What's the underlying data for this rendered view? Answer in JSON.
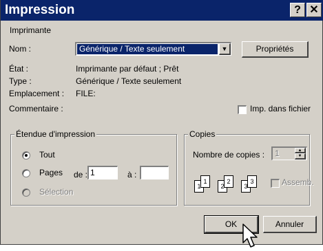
{
  "window": {
    "title": "Impression"
  },
  "printer": {
    "section_label": "Imprimante",
    "name_label": "Nom :",
    "name_value": "Générique / Texte seulement",
    "properties_button": "Propriétés",
    "state_label": "État :",
    "state_value": "Imprimante par défaut ; Prêt",
    "type_label": "Type :",
    "type_value": "Générique / Texte seulement",
    "location_label": "Emplacement :",
    "location_value": "FILE:",
    "comment_label": "Commentaire :",
    "print_to_file_label": "Imp. dans fichier"
  },
  "range": {
    "title": "Étendue d'impression",
    "all_label": "Tout",
    "pages_label": "Pages",
    "from_label": "de :",
    "from_value": "1",
    "to_label": "à :",
    "to_value": "",
    "selection_label": "Sélection"
  },
  "copies": {
    "title": "Copies",
    "count_label": "Nombre de copies :",
    "count_value": "1",
    "collate_label": "Assemb.",
    "page_numbers": [
      "1",
      "1",
      "2",
      "2",
      "3",
      "3"
    ]
  },
  "actions": {
    "ok": "OK",
    "cancel": "Annuler"
  }
}
